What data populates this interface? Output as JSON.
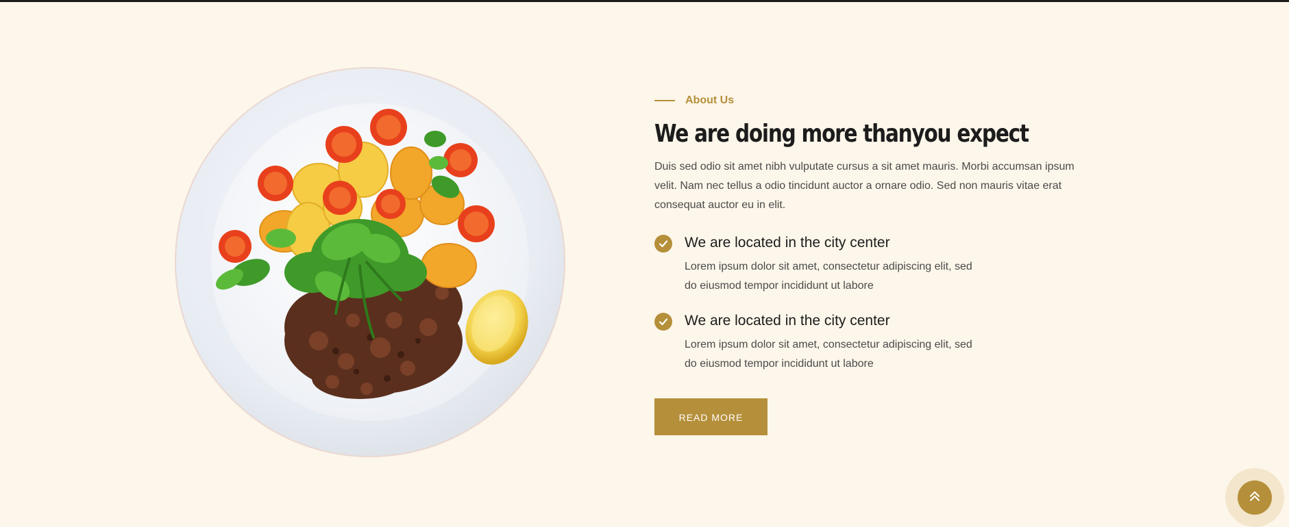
{
  "colors": {
    "accent": "#b58f3a",
    "background": "#fdf6ea",
    "heading": "#1c1c1c",
    "body_text": "#4a4a4a"
  },
  "about": {
    "eyebrow": "About Us",
    "headline": "We are doing more thanyou expect",
    "lead": "Duis sed odio sit amet nibh vulputate cursus a sit amet mauris. Morbi accumsan ipsum velit. Nam nec tellus a odio tincidunt auctor a ornare odio. Sed non mauris vitae erat consequat auctor eu in elit.",
    "features": [
      {
        "icon": "check-circle-icon",
        "title": "We are located in the city center",
        "text": "Lorem ipsum dolor sit amet, consectetur adipiscing elit, sed do eiusmod tempor incididunt ut labore"
      },
      {
        "icon": "check-circle-icon",
        "title": "We are located in the city center",
        "text": "Lorem ipsum dolor sit amet, consectetur adipiscing elit, sed do eiusmod tempor incididunt ut labore"
      }
    ],
    "button_label": "READ MORE"
  },
  "plate_image": {
    "icon": "food-plate-image"
  },
  "back_to_top": {
    "icon": "double-chevron-up-icon"
  }
}
